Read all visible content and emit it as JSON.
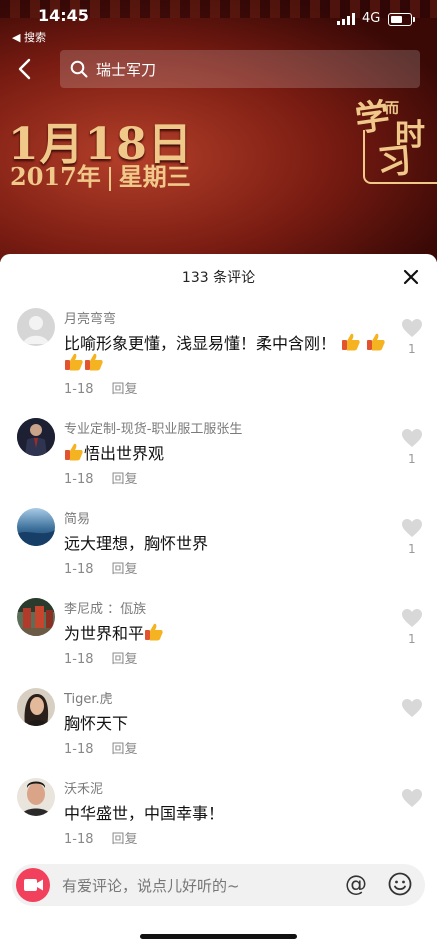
{
  "status": {
    "time": "14:45",
    "back_app": "◀ 搜索",
    "network": "4G"
  },
  "search": {
    "query": "瑞士军刀"
  },
  "video": {
    "date_big": "1月18日",
    "year": "2017年",
    "weekday": "星期三",
    "logo_chars": [
      "学",
      "而",
      "时",
      "习"
    ]
  },
  "comments_panel": {
    "title": "133 条评论",
    "comments": [
      {
        "name": "月亮弯弯",
        "text": "比喻形象更懂，浅显易懂！柔中含刚！",
        "thumbs_inline": 2,
        "thumbs_next_line": 2,
        "date": "1-18",
        "reply": "回复",
        "likes": "1",
        "avatar_color": "#cfcfcf"
      },
      {
        "name": "专业定制-现货-职业服工服张生",
        "text_before": "",
        "text": "悟出世界观",
        "thumbs_before": 1,
        "date": "1-18",
        "reply": "回复",
        "likes": "1",
        "avatar_color": "#2b2f45"
      },
      {
        "name": "简易",
        "text": "远大理想，胸怀世界",
        "date": "1-18",
        "reply": "回复",
        "likes": "1",
        "avatar_color": "#3b6f9a"
      },
      {
        "name": "李尼成 ：佤族",
        "text": "为世界和平",
        "thumbs_after": 1,
        "date": "1-18",
        "reply": "回复",
        "likes": "1",
        "avatar_color": "#8a3a2e"
      },
      {
        "name": "Tiger.虎",
        "text": "胸怀天下",
        "date": "1-18",
        "reply": "回复",
        "likes": "",
        "avatar_color": "#6e5a4c"
      },
      {
        "name": "沃禾泥",
        "text": "中华盛世，中国幸事！",
        "date": "1-18",
        "reply": "回复",
        "likes": "",
        "avatar_color": "#b98d72"
      }
    ]
  },
  "input": {
    "placeholder": "有爱评论，说点儿好听的~",
    "at": "@"
  },
  "colors": {
    "accent": "#f2415c",
    "gold": "#f0c98a",
    "hero_dark": "#3a0906"
  }
}
